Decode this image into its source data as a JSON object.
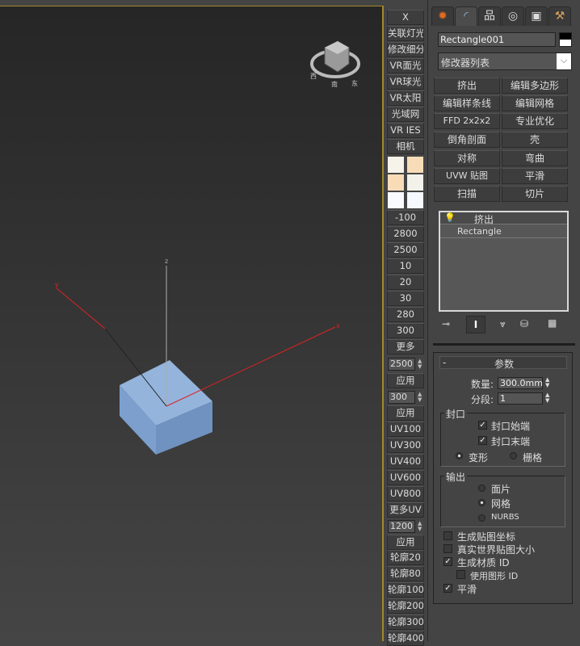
{
  "viewport": {
    "axes": {
      "x": "x",
      "y": "y",
      "z": "z"
    },
    "viewcube": {
      "labels": [
        "西",
        "南",
        "东"
      ]
    }
  },
  "toolbar": {
    "top_buttons": [
      "X",
      "关联灯光",
      "修改细分",
      "VR面光",
      "VR球光",
      "VR太阳",
      "光域网",
      "VR IES",
      "相机"
    ],
    "swatches": [
      "#f6f3ea",
      "#f8dcb8",
      "#f8dcb8",
      "#f3f2ea",
      "#f8faff",
      "#f5f8fc"
    ],
    "value_buttons": [
      "-100",
      "2800",
      "2500",
      "10",
      "20",
      "30",
      "280",
      "300",
      "更多"
    ],
    "spinner1": "2500",
    "apply1": "应用",
    "spinner2": "300",
    "apply2": "应用",
    "uv_buttons": [
      "UV100",
      "UV300",
      "UV400",
      "UV600",
      "UV800",
      "更多UV"
    ],
    "spinner3": "1200",
    "apply3": "应用",
    "outline_buttons": [
      "轮廓20",
      "轮廓80",
      "轮廓100",
      "轮廓200",
      "轮廓300",
      "轮廓400"
    ]
  },
  "panel": {
    "tabs": [
      "create",
      "modify",
      "hierarchy",
      "motion",
      "display",
      "utilities"
    ],
    "object_name": "Rectangle001",
    "modifier_list": "修改器列表",
    "modifier_buttons": [
      "挤出",
      "编辑多边形",
      "编辑样条线",
      "编辑网格",
      "FFD 2x2x2",
      "专业优化",
      "倒角剖面",
      "壳",
      "对称",
      "弯曲",
      "UVW 贴图",
      "平滑",
      "扫描",
      "切片"
    ],
    "stack": [
      "挤出",
      "Rectangle"
    ],
    "params": {
      "title": "参数",
      "collapse": "-",
      "amount_label": "数量:",
      "amount": "300.0mm",
      "segments_label": "分段:",
      "segments": "1",
      "cap_group": "封口",
      "cap_start": "封口始端",
      "cap_end": "封口末端",
      "morph": "变形",
      "grid": "栅格",
      "output_group": "输出",
      "patch": "面片",
      "mesh": "网格",
      "nurbs": "NURBS",
      "gen_map": "生成贴图坐标",
      "real_world": "真实世界贴图大小",
      "gen_mat": "生成材质 ID",
      "use_shape": "使用图形 ID",
      "smooth": "平滑"
    }
  }
}
